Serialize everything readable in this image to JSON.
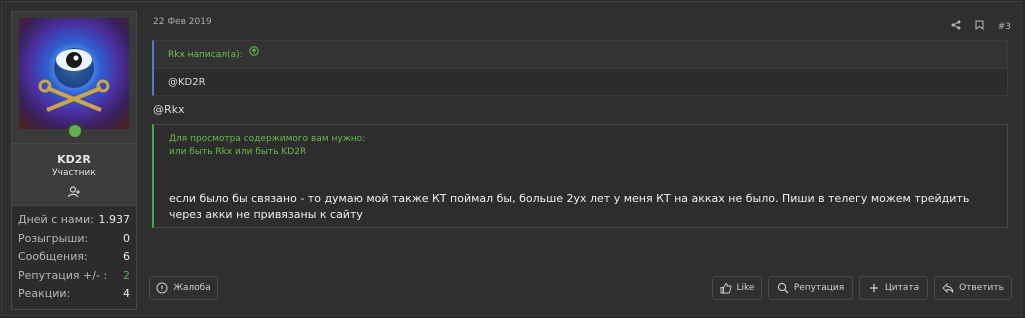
{
  "post": {
    "date": "22 Фев 2019",
    "number": "#3",
    "quote": {
      "author_line": "Rkx написал(а):",
      "text": "@KD2R"
    },
    "mention": "@Rkx",
    "hidden_notice": {
      "line1": "Для просмотра содержимого вам нужно:",
      "line2": "или быть Rkx или быть KD2R"
    },
    "body_text": "если было бы связано - то думаю мой также КТ поймал бы, больше 2ух лет у меня КТ на акках не было. Пиши в телегу можем трейдить через акки не привязаны к сайту"
  },
  "user": {
    "name": "KD2R",
    "title": "Участник",
    "stats": [
      {
        "label": "Дней с нами:",
        "value": "1.937"
      },
      {
        "label": "Розыгрыши:",
        "value": "0"
      },
      {
        "label": "Сообщения:",
        "value": "6"
      },
      {
        "label": "Репутация +/- :",
        "value": "2"
      },
      {
        "label": "Реакции:",
        "value": "4"
      }
    ],
    "online": true
  },
  "actions": {
    "report": "Жалоба",
    "like": "Like",
    "reputation": "Репутация",
    "quote": "Цитата",
    "reply": "Ответить"
  },
  "colors": {
    "accent_green": "#56b350",
    "quote_border": "#4a82c4"
  },
  "icons": [
    "share-icon",
    "bookmark-icon",
    "arrow-up-circle-icon",
    "user-add-icon",
    "info-icon",
    "thumbs-up-icon",
    "search-icon",
    "plus-icon",
    "reply-icon"
  ]
}
